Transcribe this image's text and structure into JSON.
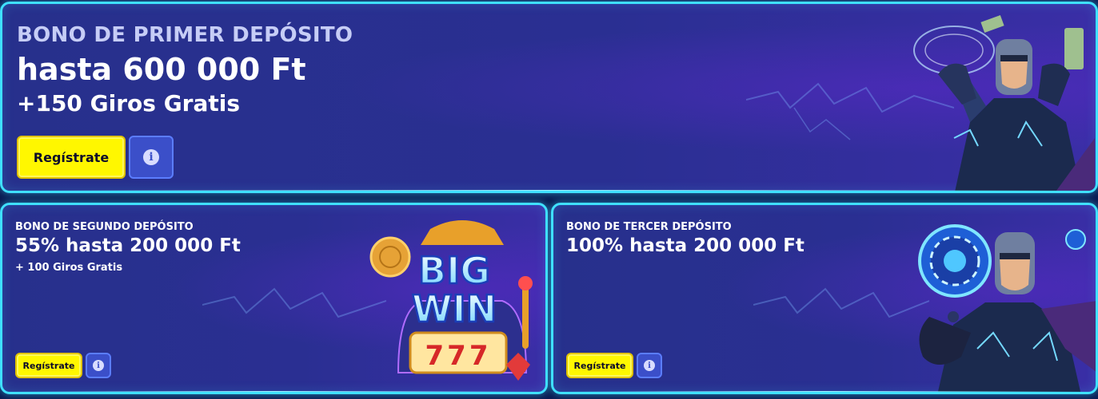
{
  "banners": [
    {
      "eyebrow": "BONO DE PRIMER DEPÓSITO",
      "title": "hasta 600 000 Ft",
      "subtitle": "+150 Giros Gratis",
      "register_label": "Regístrate",
      "info_label": "i"
    },
    {
      "eyebrow": "BONO DE SEGUNDO DEPÓSITO",
      "title": "55% hasta 200 000 Ft",
      "subtitle": "+ 100 Giros Gratis",
      "register_label": "Regístrate",
      "info_label": "i",
      "art_text": [
        "BIG",
        "WIN",
        "777"
      ]
    },
    {
      "eyebrow": "BONO DE TERCER DEPÓSITO",
      "title": "100% hasta 200 000 Ft",
      "register_label": "Regístrate",
      "info_label": "i"
    }
  ],
  "colors": {
    "border_accent": "#3fe0ff",
    "register_button": "#fff700",
    "info_button": "#3b4fc9",
    "background": "#27308c"
  },
  "icons": [
    "info-icon",
    "superhero-illustration",
    "big-win-slot-illustration",
    "casino-chip-icon",
    "lightning-decoration"
  ]
}
